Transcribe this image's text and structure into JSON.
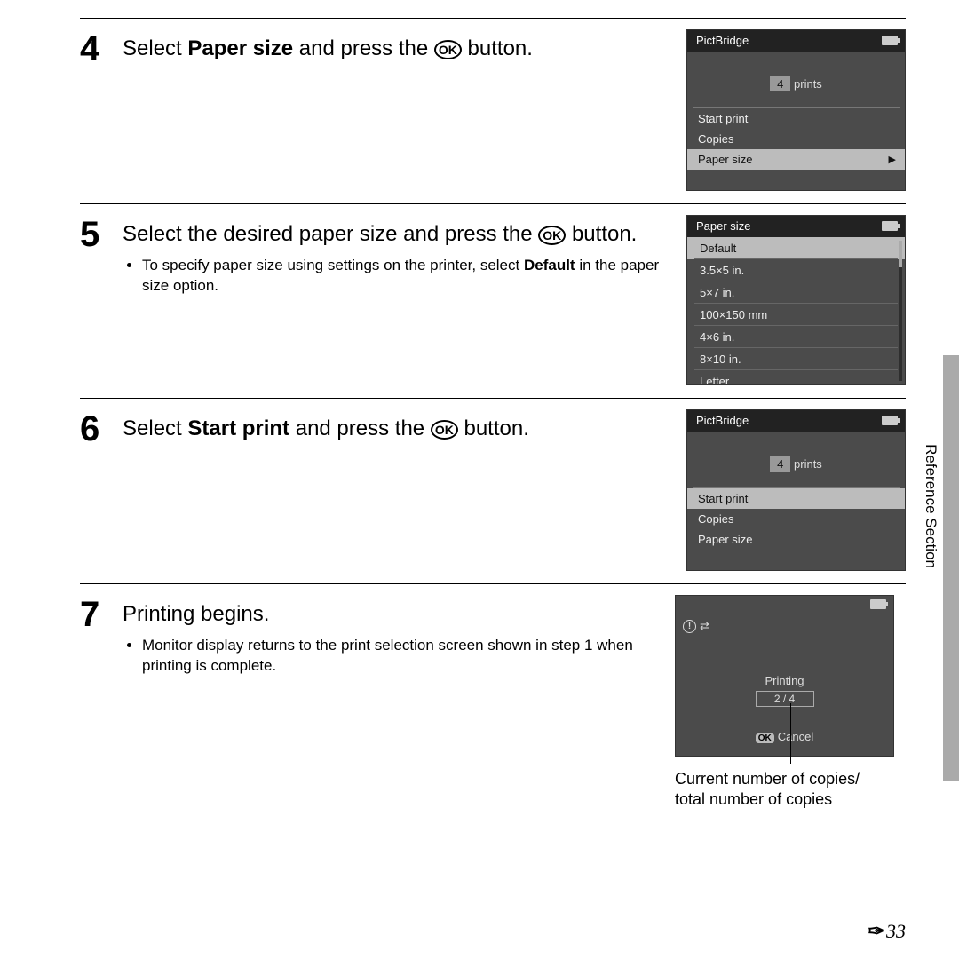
{
  "steps": {
    "s4": {
      "num": "4",
      "text_pre": "Select ",
      "bold": "Paper size",
      "text_mid": " and press the ",
      "ok": "OK",
      "text_post": " button."
    },
    "s5": {
      "num": "5",
      "text_pre": "Select the desired paper size and press the ",
      "ok": "OK",
      "text_post": " button.",
      "bullet_pre": "To specify paper size using settings on the printer, select ",
      "bullet_bold": "Default",
      "bullet_post": " in the paper size option."
    },
    "s6": {
      "num": "6",
      "text_pre": "Select ",
      "bold": "Start print",
      "text_mid": " and press the ",
      "ok": "OK",
      "text_post": " button."
    },
    "s7": {
      "num": "7",
      "title": "Printing begins.",
      "bullet": "Monitor display returns to the print selection screen shown in step 1 when printing is complete."
    }
  },
  "screen4": {
    "title": "PictBridge",
    "prints_count": "4",
    "prints_label": " prints",
    "items": [
      "Start print",
      "Copies",
      "Paper size"
    ],
    "selected_index": 2
  },
  "screen5": {
    "title": "Paper size",
    "items": [
      "Default",
      "3.5×5 in.",
      "5×7 in.",
      "100×150 mm",
      "4×6 in.",
      "8×10 in.",
      "Letter"
    ],
    "selected_index": 0
  },
  "screen6": {
    "title": "PictBridge",
    "prints_count": "4",
    "prints_label": " prints",
    "items": [
      "Start print",
      "Copies",
      "Paper size"
    ],
    "selected_index": 0
  },
  "screen7": {
    "printing": "Printing",
    "progress": "2 / 4",
    "ok": "OK",
    "cancel": "Cancel",
    "callout_l1": "Current number of copies/",
    "callout_l2": "total number of copies"
  },
  "side_label": "Reference Section",
  "page_number": "33"
}
